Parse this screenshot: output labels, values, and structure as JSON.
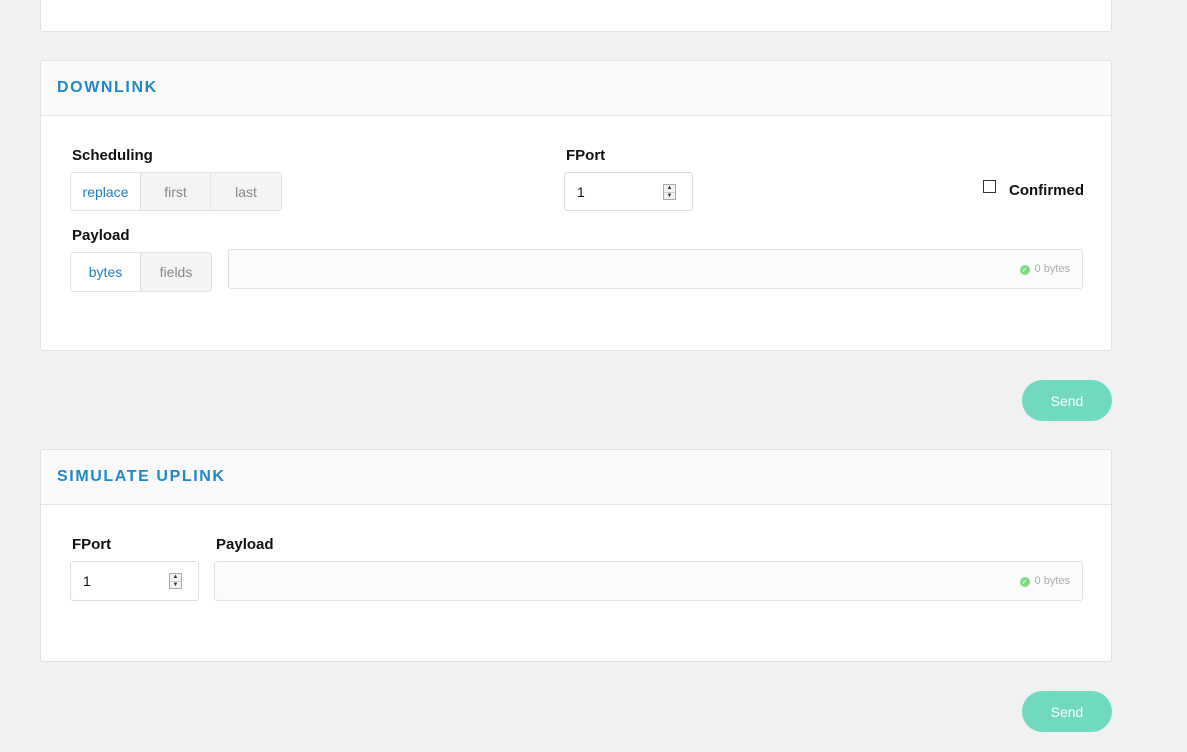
{
  "downlink": {
    "title": "DOWNLINK",
    "scheduling_label": "Scheduling",
    "scheduling_options": [
      "replace",
      "first",
      "last"
    ],
    "scheduling_selected": "replace",
    "fport_label": "FPort",
    "fport_value": "1",
    "confirmed_label": "Confirmed",
    "confirmed_checked": false,
    "payload_label": "Payload",
    "payload_modes": [
      "bytes",
      "fields"
    ],
    "payload_mode_selected": "bytes",
    "payload_value": "",
    "payload_size": "0 bytes",
    "send_label": "Send"
  },
  "uplink": {
    "title": "SIMULATE UPLINK",
    "fport_label": "FPort",
    "fport_value": "1",
    "payload_label": "Payload",
    "payload_value": "",
    "payload_size": "0 bytes",
    "send_label": "Send"
  },
  "colors": {
    "accent": "#1e88c9",
    "send_button": "#72d9c1",
    "valid_dot": "#7fdc84",
    "background": "#f1f1f1"
  }
}
